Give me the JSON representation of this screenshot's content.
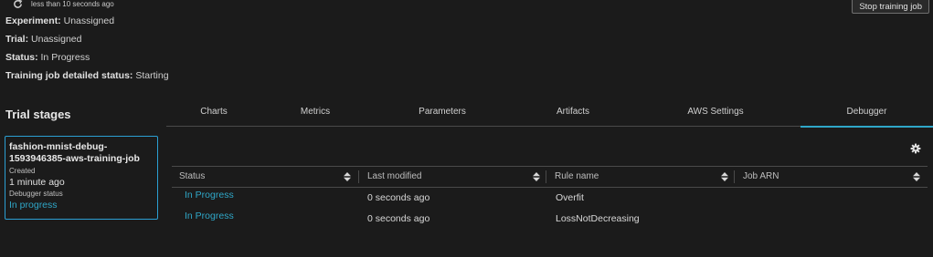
{
  "header": {
    "refresh_text": "less than 10 seconds ago",
    "stop_button": "Stop training job"
  },
  "details": {
    "experiment_label": "Experiment:",
    "experiment_value": "Unassigned",
    "trial_label": "Trial:",
    "trial_value": "Unassigned",
    "status_label": "Status:",
    "status_value": "In Progress",
    "job_status_label": "Training job detailed status:",
    "job_status_value": "Starting"
  },
  "trial_stages": {
    "title": "Trial stages",
    "card": {
      "name_line1": "fashion-mnist-debug-",
      "name_line2": "1593946385-aws-training-job",
      "created_label": "Created",
      "created_value": "1 minute ago",
      "debugger_label": "Debugger status",
      "debugger_value": "In progress"
    }
  },
  "tabs": [
    {
      "label": "Charts"
    },
    {
      "label": "Metrics"
    },
    {
      "label": "Parameters"
    },
    {
      "label": "Artifacts"
    },
    {
      "label": "AWS Settings"
    },
    {
      "label": "Debugger",
      "active": true
    }
  ],
  "table": {
    "columns": [
      "Status",
      "Last modified",
      "Rule name",
      "Job ARN"
    ],
    "rows": [
      {
        "status": "In Progress",
        "last_modified": "0 seconds ago",
        "rule_name": "Overfit",
        "job_arn": ""
      },
      {
        "status": "In Progress",
        "last_modified": "0 seconds ago",
        "rule_name": "LossNotDecreasing",
        "job_arn": ""
      }
    ]
  },
  "colors": {
    "background": "#1b1b1b",
    "accent": "#2fa7c8",
    "card_border": "#2b9fd3"
  },
  "icons": [
    "refresh-icon",
    "gear-icon",
    "sort-icon"
  ]
}
